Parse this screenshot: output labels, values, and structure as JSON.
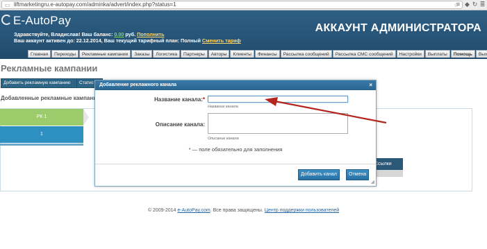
{
  "browser": {
    "url": "liftmarketingru.e-autopay.com/adminka/advert/index.php?status=1",
    "star_icon": "star-icon",
    "toolbar_icons": [
      "menu-icon",
      "extension-icon",
      "sync-icon",
      "settings-icon"
    ]
  },
  "header": {
    "logo_text": "E-AutoPay",
    "greeting_prefix": "Здравствуйте, Владислав!  Ваш баланс:",
    "balance": "0.00",
    "balance_suffix": "руб.",
    "topup_link": "Пополнить",
    "account_line_prefix": "Ваш аккаунт активен до: 22.12.2014, Ваш текущий тарифный план: Полный",
    "change_plan_link": "Сменить тариф",
    "admin_title": "АККАУНТ АДМИНИСТРАТОРА"
  },
  "nav": {
    "tabs": [
      {
        "label": "Главная"
      },
      {
        "label": "Переходы"
      },
      {
        "label": "Рекламные кампании"
      },
      {
        "label": "Заказы"
      },
      {
        "label": "Логистика"
      },
      {
        "label": "Партнеры"
      },
      {
        "label": "Авторы"
      },
      {
        "label": "Клиенты"
      },
      {
        "label": "Финансы"
      },
      {
        "label": "Рассылка сообщений"
      },
      {
        "label": "Рассылка СМС сообщений"
      },
      {
        "label": "Настройки"
      },
      {
        "label": "Выплаты"
      },
      {
        "label": "Помощь"
      },
      {
        "label": "Выход"
      }
    ]
  },
  "page": {
    "title": "Рекламные кампании",
    "add_campaign_button": "Добавить рекламную кампанию",
    "stats_button": "Статистика",
    "section_label": "Добавленные рекламные кампании",
    "campaign_tab": "РК 1",
    "campaign_cell": "1",
    "links_header": "Ссылки"
  },
  "footer": {
    "copyright": "© 2009-2014",
    "site_link": "e-AutoPay.com",
    "rights": ". Все права защищены.",
    "support_link": "Центр поддержки пользователей"
  },
  "modal": {
    "title": "Добавление рекламного канала",
    "close_symbol": "×",
    "name_label": "Название канала:",
    "required_mark": "*",
    "name_value": "",
    "name_hint": "Название канала",
    "description_label": "Описание канала:",
    "description_value": "",
    "description_hint": "Описание канала",
    "required_note": "* — поле обязательно для заполнения",
    "add_button": "Добавить канал",
    "cancel_button": "Отмена"
  },
  "colors": {
    "header_bg": "#2a5678",
    "annotation_arrow": "#b3261e",
    "campaign_tab_green": "#9dcc6c",
    "campaign_cell_blue": "#2d90c0"
  }
}
